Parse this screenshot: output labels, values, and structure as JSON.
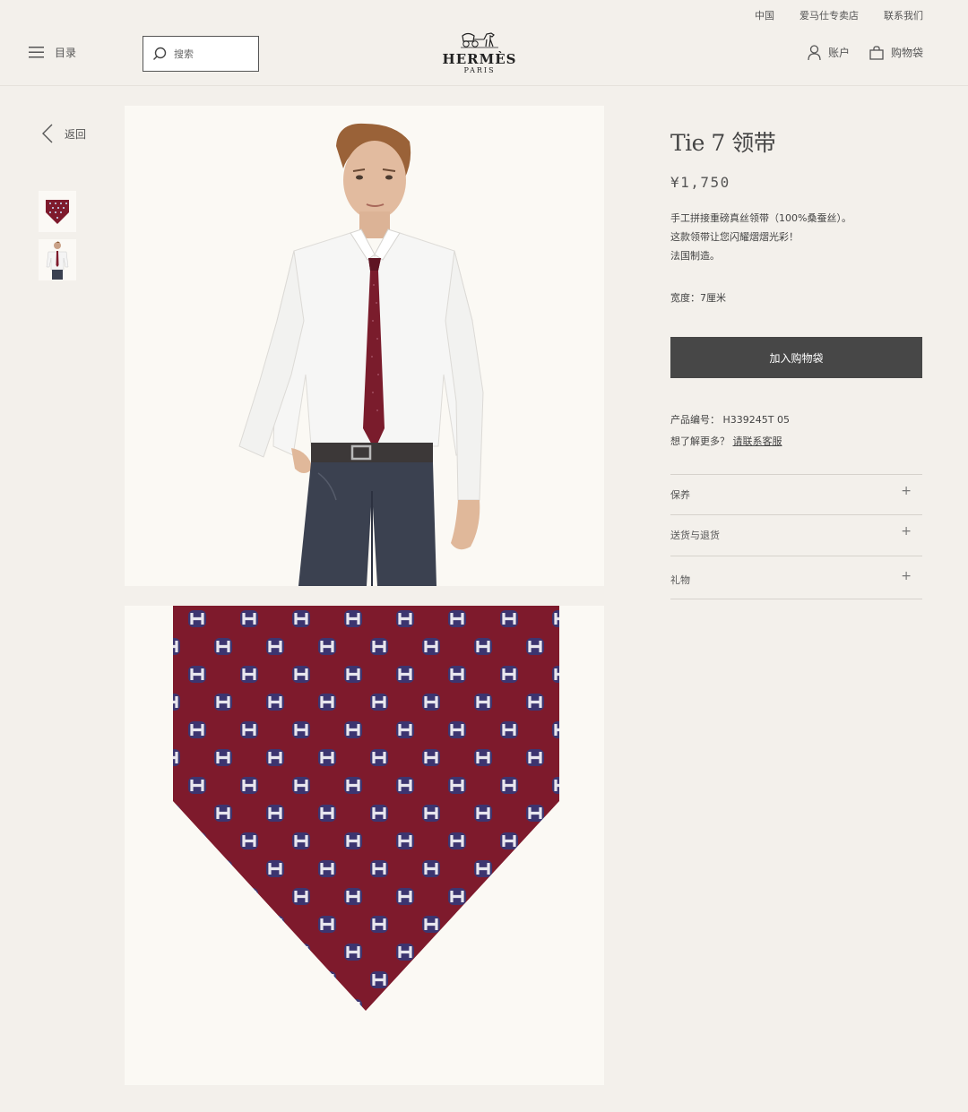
{
  "top_links": [
    "中国",
    "爱马仕专卖店",
    "联系我们"
  ],
  "header": {
    "menu_label": "目录",
    "search_placeholder": "搜索",
    "logo_text": "HERMÈS",
    "logo_sub": "PARIS",
    "account_label": "账户",
    "bag_label": "购物袋"
  },
  "nav": {
    "back_label": "返回"
  },
  "product": {
    "title": "Tie 7 领带",
    "price": "¥1,750",
    "description": [
      "手工拼接重磅真丝领带（100%桑蚕丝）。",
      "这款领带让您闪耀熠熠光彩！",
      "法国制造。"
    ],
    "width": "宽度：7厘米",
    "add_to_bag": "加入购物袋",
    "code": "产品编号： H339245T 05",
    "more_prefix": "想了解更多？",
    "more_link": "请联系客服"
  },
  "accordion": [
    {
      "label": "保养",
      "icon": "plus-icon"
    },
    {
      "label": "送货与退货",
      "icon": "plus-icon"
    },
    {
      "label": "礼物",
      "icon": "plus-icon"
    }
  ],
  "colors": {
    "tie": "#7e1a2c",
    "button": "#474747",
    "background": "#f3f0eb"
  }
}
